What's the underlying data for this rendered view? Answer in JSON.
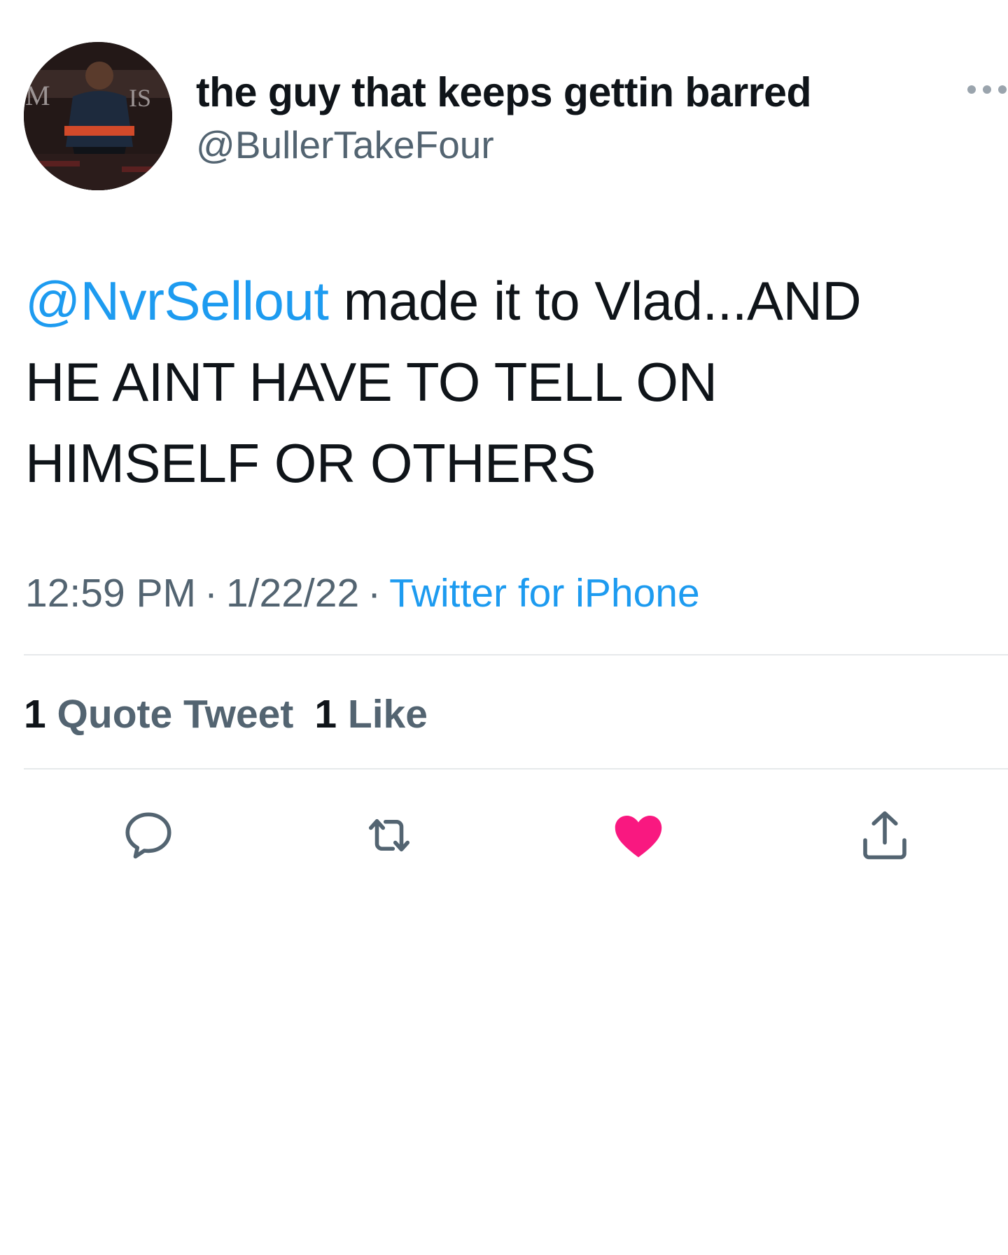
{
  "tweet": {
    "author": {
      "display_name": "the guy that keeps gettin barred",
      "handle": "@BullerTakeFour"
    },
    "text": {
      "mention": "@NvrSellout",
      "line1_rest": " made it to Vlad...AND",
      "line2": "HE AINT HAVE TO TELL ON",
      "line3": "HIMSELF OR OTHERS"
    },
    "meta": {
      "time": "12:59 PM",
      "separator": "·",
      "date": "1/22/22",
      "source": "Twitter for iPhone"
    },
    "stats": {
      "quote_count": "1",
      "quote_label": "Quote Tweet",
      "like_count": "1",
      "like_label": "Like"
    },
    "actions": [
      {
        "name": "reply",
        "icon": "reply-icon"
      },
      {
        "name": "retweet",
        "icon": "retweet-icon"
      },
      {
        "name": "like",
        "icon": "heart-icon",
        "active": true
      },
      {
        "name": "share",
        "icon": "share-icon"
      }
    ],
    "colors": {
      "accent": "#1d9bf0",
      "like_active": "#f91880",
      "secondary_text": "#536471",
      "icon_gray": "#536471"
    }
  }
}
